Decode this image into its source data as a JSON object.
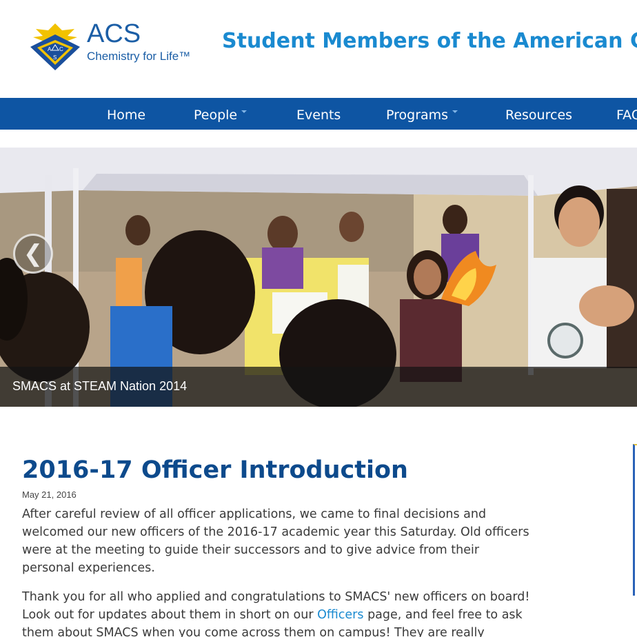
{
  "header": {
    "logo_acs": "ACS",
    "logo_tagline": "Chemistry for Life™",
    "site_title": "Student Members of the American Chem",
    "brand_color": "#1b5ea6",
    "title_color": "#1a8ad0"
  },
  "nav": {
    "items": [
      {
        "label": "Home",
        "dropdown": false
      },
      {
        "label": "People",
        "dropdown": true
      },
      {
        "label": "Events",
        "dropdown": false
      },
      {
        "label": "Programs",
        "dropdown": true
      },
      {
        "label": "Resources",
        "dropdown": false
      },
      {
        "label": "FAQ",
        "dropdown": false
      }
    ],
    "bg_color": "#0e55a3"
  },
  "slider": {
    "caption": "SMACS at STEAM Nation 2014",
    "prev_icon": "chevron-left-icon",
    "prev_glyph": "❮"
  },
  "article": {
    "title": "2016-17 Officer Introduction",
    "date": "May 21, 2016",
    "para1": "After careful review of all officer applications, we came to final decisions and welcomed our new officers of the 2016-17 academic year this Saturday. Old officers were at the meeting to guide their successors and to give advice from their personal experiences.",
    "para2_before": "Thank you for all who applied and congratulations to SMACS' new officers on board! Look out for updates about them in short on our ",
    "para2_link": "Officers",
    "para2_after": " page, and feel free to ask them about SMACS when you come across them on campus! They are really excited to work with you in the following year!"
  }
}
